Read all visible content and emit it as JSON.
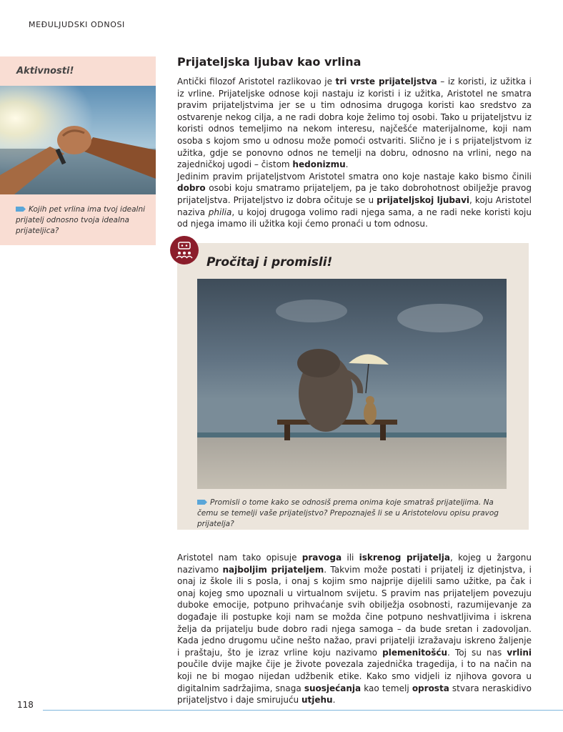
{
  "header": "MEĐULJUDSKI ODNOSI",
  "sidebar": {
    "title": "Aktivnosti!",
    "question": "Kojih pet vrlina ima tvoj idealni prijatelj odnosno tvoja idealna prijateljica?"
  },
  "section": {
    "title": "Prijateljska ljubav kao vrlina",
    "p1": [
      {
        "t": "Antički filozof Aristotel razlikovao je "
      },
      {
        "t": "tri vrste prijateljstva",
        "b": true
      },
      {
        "t": " – iz koristi, iz užitka i iz vrline. Prijateljske odnose koji nastaju iz koristi i iz užitka, Aristotel ne smatra pravim prijateljstvima jer se u tim odnosima drugoga koristi kao sredstvo za ostvarenje nekog cilja, a ne radi dobra koje želimo toj osobi. Tako u prijateljstvu iz koristi odnos temeljimo na nekom interesu, najčešće materijalnome, koji nam osoba s kojom smo u odnosu može pomoći ostvariti. Slično je i s prijateljstvom iz užitka, gdje se ponovno odnos ne temelji na dobru, odnosno na vrlini, nego na zajedničkoj ugodi – čistom "
      },
      {
        "t": "hedonizmu",
        "b": true
      },
      {
        "t": "."
      }
    ],
    "p2": [
      {
        "t": "Jedinim pravim prijateljstvom Aristotel smatra ono koje nastaje kako bismo činili "
      },
      {
        "t": "dobro",
        "b": true
      },
      {
        "t": " osobi koju smatramo prijateljem, pa je tako dobrohotnost obilježje pravog prijateljstva. Prijateljstvo iz dobra očituje se u "
      },
      {
        "t": "prijateljskoj ljubavi",
        "b": true
      },
      {
        "t": ", koju Aristotel naziva "
      },
      {
        "t": "philia",
        "i": true
      },
      {
        "t": ", u kojoj drugoga volimo radi njega sama, a ne radi neke koristi koju od njega imamo ili užitka koji ćemo pronaći u tom odnosu."
      }
    ]
  },
  "box": {
    "title": "Pročitaj i promisli!",
    "question": "Promisli o tome kako se odnosiš prema onima koje smatraš prijateljima. Na čemu se temelji vaše prijateljstvo? Prepoznaješ li se u Aristotelovu opisu pravog prijatelja?"
  },
  "p3": [
    {
      "t": "Aristotel nam tako opisuje "
    },
    {
      "t": "pravoga",
      "b": true
    },
    {
      "t": " ili "
    },
    {
      "t": "iskrenog prijatelja",
      "b": true
    },
    {
      "t": ", kojeg u žargonu nazivamo "
    },
    {
      "t": "najboljim prijateljem",
      "b": true
    },
    {
      "t": ". Takvim može postati i prijatelj iz djetinjstva, i onaj iz škole ili s posla, i onaj s kojim smo najprije dijelili samo užitke, pa čak i onaj kojeg smo upoznali u virtualnom svijetu. S pravim nas prijateljem povezuju duboke emocije, potpuno prihvaćanje svih obilježja osobnosti, razumijevanje za događaje ili postupke koji nam se možda čine potpuno neshvatljivima i iskrena želja da prijatelju bude dobro radi njega samoga – da bude sretan i zadovoljan. Kada jedno drugomu učine nešto nažao, pravi prijatelji izražavaju iskreno žaljenje i praštaju, što je izraz vrline koju nazivamo "
    },
    {
      "t": "plemenitošću",
      "b": true
    },
    {
      "t": ". Toj su nas "
    },
    {
      "t": "vrlini",
      "b": true
    },
    {
      "t": " poučile dvije majke čije je živote povezala zajednička tragedija, i to na način na koji ne bi mogao nijedan udžbenik etike. Kako smo vidjeli iz njihova govora u digitalnim sadržajima, snaga "
    },
    {
      "t": "suosjećanja",
      "b": true
    },
    {
      "t": " kao temelj "
    },
    {
      "t": "oprosta",
      "b": true
    },
    {
      "t": " stvara neraskidivo prijateljstvo i daje smirujuću "
    },
    {
      "t": "utjehu",
      "b": true
    },
    {
      "t": "."
    }
  ],
  "page_number": "118",
  "colors": {
    "sidebar_bg": "#f9ddd3",
    "box_bg": "#ece5dc",
    "icon_bg": "#8b1d2b",
    "accent_blue": "#5aa6d8"
  }
}
